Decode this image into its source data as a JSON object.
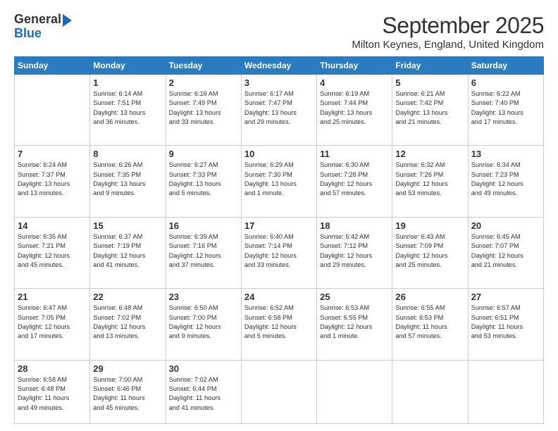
{
  "header": {
    "logo_line1": "General",
    "logo_line2": "Blue",
    "month": "September 2025",
    "location": "Milton Keynes, England, United Kingdom"
  },
  "days_of_week": [
    "Sunday",
    "Monday",
    "Tuesday",
    "Wednesday",
    "Thursday",
    "Friday",
    "Saturday"
  ],
  "weeks": [
    [
      {
        "day": "",
        "text": ""
      },
      {
        "day": "1",
        "text": "Sunrise: 6:14 AM\nSunset: 7:51 PM\nDaylight: 13 hours\nand 36 minutes."
      },
      {
        "day": "2",
        "text": "Sunrise: 6:16 AM\nSunset: 7:49 PM\nDaylight: 13 hours\nand 33 minutes."
      },
      {
        "day": "3",
        "text": "Sunrise: 6:17 AM\nSunset: 7:47 PM\nDaylight: 13 hours\nand 29 minutes."
      },
      {
        "day": "4",
        "text": "Sunrise: 6:19 AM\nSunset: 7:44 PM\nDaylight: 13 hours\nand 25 minutes."
      },
      {
        "day": "5",
        "text": "Sunrise: 6:21 AM\nSunset: 7:42 PM\nDaylight: 13 hours\nand 21 minutes."
      },
      {
        "day": "6",
        "text": "Sunrise: 6:22 AM\nSunset: 7:40 PM\nDaylight: 13 hours\nand 17 minutes."
      }
    ],
    [
      {
        "day": "7",
        "text": "Sunrise: 6:24 AM\nSunset: 7:37 PM\nDaylight: 13 hours\nand 13 minutes."
      },
      {
        "day": "8",
        "text": "Sunrise: 6:26 AM\nSunset: 7:35 PM\nDaylight: 13 hours\nand 9 minutes."
      },
      {
        "day": "9",
        "text": "Sunrise: 6:27 AM\nSunset: 7:33 PM\nDaylight: 13 hours\nand 5 minutes."
      },
      {
        "day": "10",
        "text": "Sunrise: 6:29 AM\nSunset: 7:30 PM\nDaylight: 13 hours\nand 1 minute."
      },
      {
        "day": "11",
        "text": "Sunrise: 6:30 AM\nSunset: 7:28 PM\nDaylight: 12 hours\nand 57 minutes."
      },
      {
        "day": "12",
        "text": "Sunrise: 6:32 AM\nSunset: 7:26 PM\nDaylight: 12 hours\nand 53 minutes."
      },
      {
        "day": "13",
        "text": "Sunrise: 6:34 AM\nSunset: 7:23 PM\nDaylight: 12 hours\nand 49 minutes."
      }
    ],
    [
      {
        "day": "14",
        "text": "Sunrise: 6:35 AM\nSunset: 7:21 PM\nDaylight: 12 hours\nand 45 minutes."
      },
      {
        "day": "15",
        "text": "Sunrise: 6:37 AM\nSunset: 7:19 PM\nDaylight: 12 hours\nand 41 minutes."
      },
      {
        "day": "16",
        "text": "Sunrise: 6:39 AM\nSunset: 7:16 PM\nDaylight: 12 hours\nand 37 minutes."
      },
      {
        "day": "17",
        "text": "Sunrise: 6:40 AM\nSunset: 7:14 PM\nDaylight: 12 hours\nand 33 minutes."
      },
      {
        "day": "18",
        "text": "Sunrise: 6:42 AM\nSunset: 7:12 PM\nDaylight: 12 hours\nand 29 minutes."
      },
      {
        "day": "19",
        "text": "Sunrise: 6:43 AM\nSunset: 7:09 PM\nDaylight: 12 hours\nand 25 minutes."
      },
      {
        "day": "20",
        "text": "Sunrise: 6:45 AM\nSunset: 7:07 PM\nDaylight: 12 hours\nand 21 minutes."
      }
    ],
    [
      {
        "day": "21",
        "text": "Sunrise: 6:47 AM\nSunset: 7:05 PM\nDaylight: 12 hours\nand 17 minutes."
      },
      {
        "day": "22",
        "text": "Sunrise: 6:48 AM\nSunset: 7:02 PM\nDaylight: 12 hours\nand 13 minutes."
      },
      {
        "day": "23",
        "text": "Sunrise: 6:50 AM\nSunset: 7:00 PM\nDaylight: 12 hours\nand 9 minutes."
      },
      {
        "day": "24",
        "text": "Sunrise: 6:52 AM\nSunset: 6:58 PM\nDaylight: 12 hours\nand 5 minutes."
      },
      {
        "day": "25",
        "text": "Sunrise: 6:53 AM\nSunset: 6:55 PM\nDaylight: 12 hours\nand 1 minute."
      },
      {
        "day": "26",
        "text": "Sunrise: 6:55 AM\nSunset: 6:53 PM\nDaylight: 11 hours\nand 57 minutes."
      },
      {
        "day": "27",
        "text": "Sunrise: 6:57 AM\nSunset: 6:51 PM\nDaylight: 11 hours\nand 53 minutes."
      }
    ],
    [
      {
        "day": "28",
        "text": "Sunrise: 6:58 AM\nSunset: 6:48 PM\nDaylight: 11 hours\nand 49 minutes."
      },
      {
        "day": "29",
        "text": "Sunrise: 7:00 AM\nSunset: 6:46 PM\nDaylight: 11 hours\nand 45 minutes."
      },
      {
        "day": "30",
        "text": "Sunrise: 7:02 AM\nSunset: 6:44 PM\nDaylight: 11 hours\nand 41 minutes."
      },
      {
        "day": "",
        "text": ""
      },
      {
        "day": "",
        "text": ""
      },
      {
        "day": "",
        "text": ""
      },
      {
        "day": "",
        "text": ""
      }
    ]
  ]
}
